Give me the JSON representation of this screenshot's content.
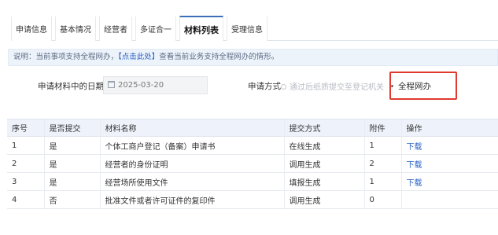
{
  "tabs": [
    {
      "label": "申请信息"
    },
    {
      "label": "基本情况"
    },
    {
      "label": "经营者"
    },
    {
      "label": "多证合一"
    },
    {
      "label": "材料列表"
    },
    {
      "label": "受理信息"
    }
  ],
  "active_tab": "材料列表",
  "notice": {
    "prefix": "说明：当前事项支持全程网办，",
    "link": "【点击此处】",
    "suffix": "查看当前业务支持全程网办的情形。"
  },
  "form": {
    "date_label": "申请材料中的日期",
    "date_value": "2025-03-20",
    "method_label": "申请方式",
    "method_option_1": "通过后纸质提交至登记机关",
    "method_option_2": "全程网办"
  },
  "table": {
    "headers": [
      "序号",
      "是否提交",
      "材料名称",
      "提交方式",
      "附件",
      "操作"
    ],
    "rows": [
      {
        "no": "1",
        "submitted": "是",
        "name": "个体工商户登记（备案）申请书",
        "method": "在线生成",
        "attach": "1",
        "action": "下载"
      },
      {
        "no": "2",
        "submitted": "是",
        "name": "经营者的身份证明",
        "method": "调用生成",
        "attach": "2",
        "action": "下载"
      },
      {
        "no": "3",
        "submitted": "是",
        "name": "经营场所使用文件",
        "method": "填报生成",
        "attach": "1",
        "action": "下载"
      },
      {
        "no": "4",
        "submitted": "否",
        "name": "批准文件或者许可证件的复印件",
        "method": "调用生成",
        "attach": "0",
        "action": ""
      }
    ]
  }
}
